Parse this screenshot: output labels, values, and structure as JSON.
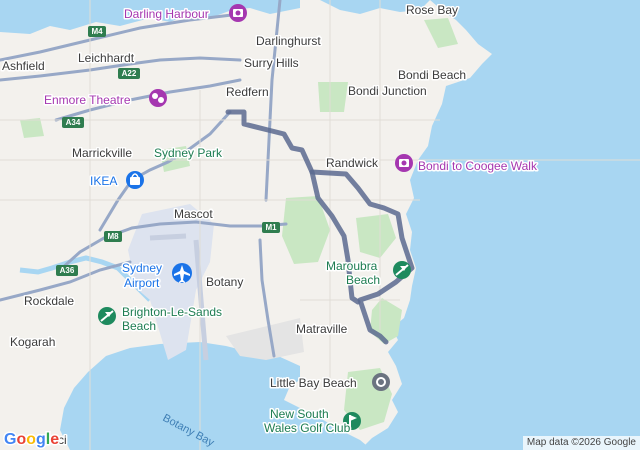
{
  "map": {
    "provider_logo": "Google",
    "attribution": "Map data ©2026 Google",
    "colors": {
      "water": "#a8d6f2",
      "land": "#f3f1ed",
      "park": "#c9e7c3",
      "airport": "#dde3ef",
      "route": "#5b6a8f",
      "poi_purple": "#a537b0",
      "poi_green": "#1e8a5e",
      "poi_blue": "#1a73e8"
    },
    "places": {
      "darling_harbour": "Darling Harbour",
      "rose_bay": "Rose Bay",
      "darlinghurst": "Darlinghurst",
      "leichhardt": "Leichhardt",
      "surry_hills": "Surry Hills",
      "ashfield": "Ashfield",
      "bondi_beach": "Bondi Beach",
      "bondi_junction": "Bondi Junction",
      "enmore_theatre": "Enmore Theatre",
      "redfern": "Redfern",
      "marrickville": "Marrickville",
      "sydney_park": "Sydney Park",
      "randwick": "Randwick",
      "bondi_coogee_walk": "Bondi to Coogee Walk",
      "ikea": "IKEA",
      "mascot": "Mascot",
      "maroubra_beach_1": "Maroubra",
      "maroubra_beach_2": "Beach",
      "sydney_airport_1": "Sydney",
      "sydney_airport_2": "Airport",
      "botany": "Botany",
      "rockdale": "Rockdale",
      "brighton_1": "Brighton-Le-Sands",
      "brighton_2": "Beach",
      "matraville": "Matraville",
      "kogarah": "Kogarah",
      "little_bay_beach": "Little Bay Beach",
      "nsw_golf_1": "New South",
      "nsw_golf_2": "Wales Golf Club",
      "botany_bay": "Botany Bay",
      "partial_left": "ci"
    },
    "shields": {
      "m4": "M4",
      "a22": "A22",
      "a34": "A34",
      "m8": "M8",
      "a36": "A36",
      "m1": "M1"
    },
    "icons": {
      "darling_harbour": "attraction-icon",
      "enmore_theatre": "theatre-icon",
      "bondi_coogee_walk": "attraction-icon",
      "ikea": "shopping-bag-icon",
      "sydney_airport": "airplane-icon",
      "maroubra_beach": "beach-icon",
      "brighton_beach": "beach-icon",
      "little_bay_beach": "camera-icon",
      "nsw_golf": "golf-icon"
    }
  }
}
